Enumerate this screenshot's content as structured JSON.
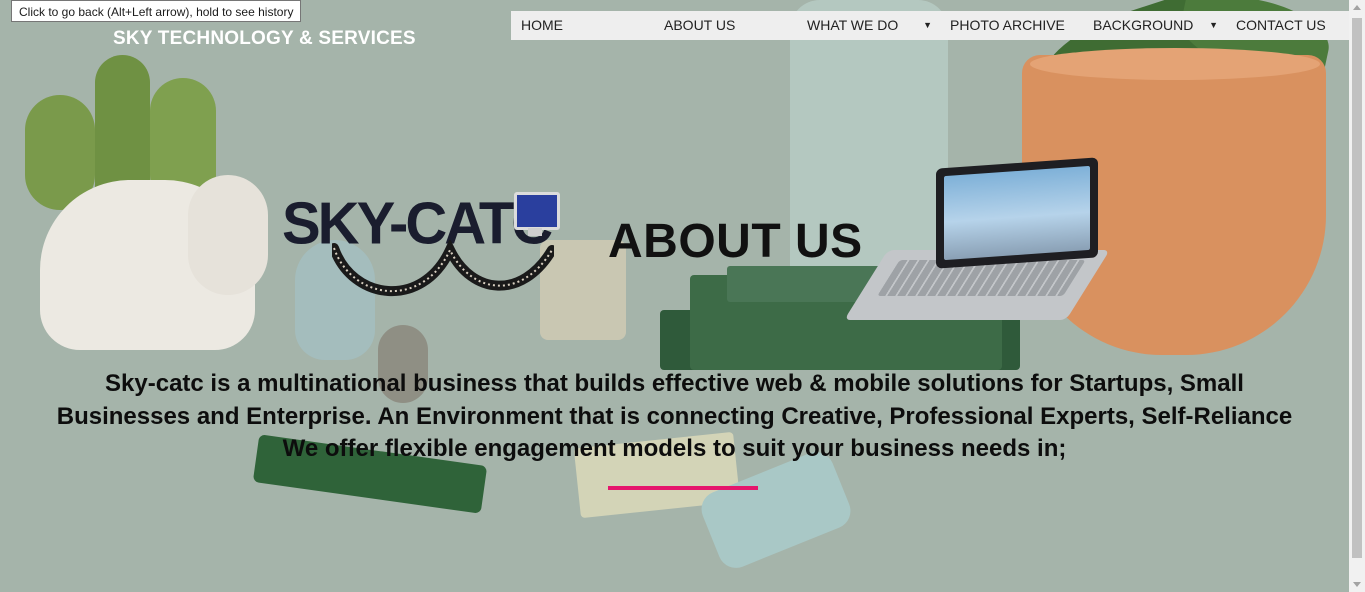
{
  "browser": {
    "tooltip": "Click to go back (Alt+Left arrow), hold to see history"
  },
  "header": {
    "brand": "SKY TECHNOLOGY & SERVICES"
  },
  "nav": {
    "items": [
      {
        "label": "HOME",
        "dropdown": false
      },
      {
        "label": "ABOUT US",
        "dropdown": false
      },
      {
        "label": "WHAT WE DO",
        "dropdown": true
      },
      {
        "label": "PHOTO ARCHIVE",
        "dropdown": false
      },
      {
        "label": "BACKGROUND",
        "dropdown": true
      },
      {
        "label": "CONTACT US",
        "dropdown": false
      }
    ]
  },
  "logo": {
    "text": "SKY-CATC"
  },
  "main": {
    "title": "ABOUT US",
    "description_lines": [
      "Sky-catc is a multinational business that builds effective web & mobile solutions for Startups, Small",
      "Businesses and Enterprise. An Environment that is connecting Creative, Professional Experts, Self-Reliance",
      "We offer flexible engagement models to suit your business needs in;"
    ]
  },
  "colors": {
    "accent_underline": "#e5166c",
    "nav_background": "#eeeeee",
    "brand_text": "#ffffff"
  },
  "icons": {
    "dropdown": "caret-down-icon"
  }
}
